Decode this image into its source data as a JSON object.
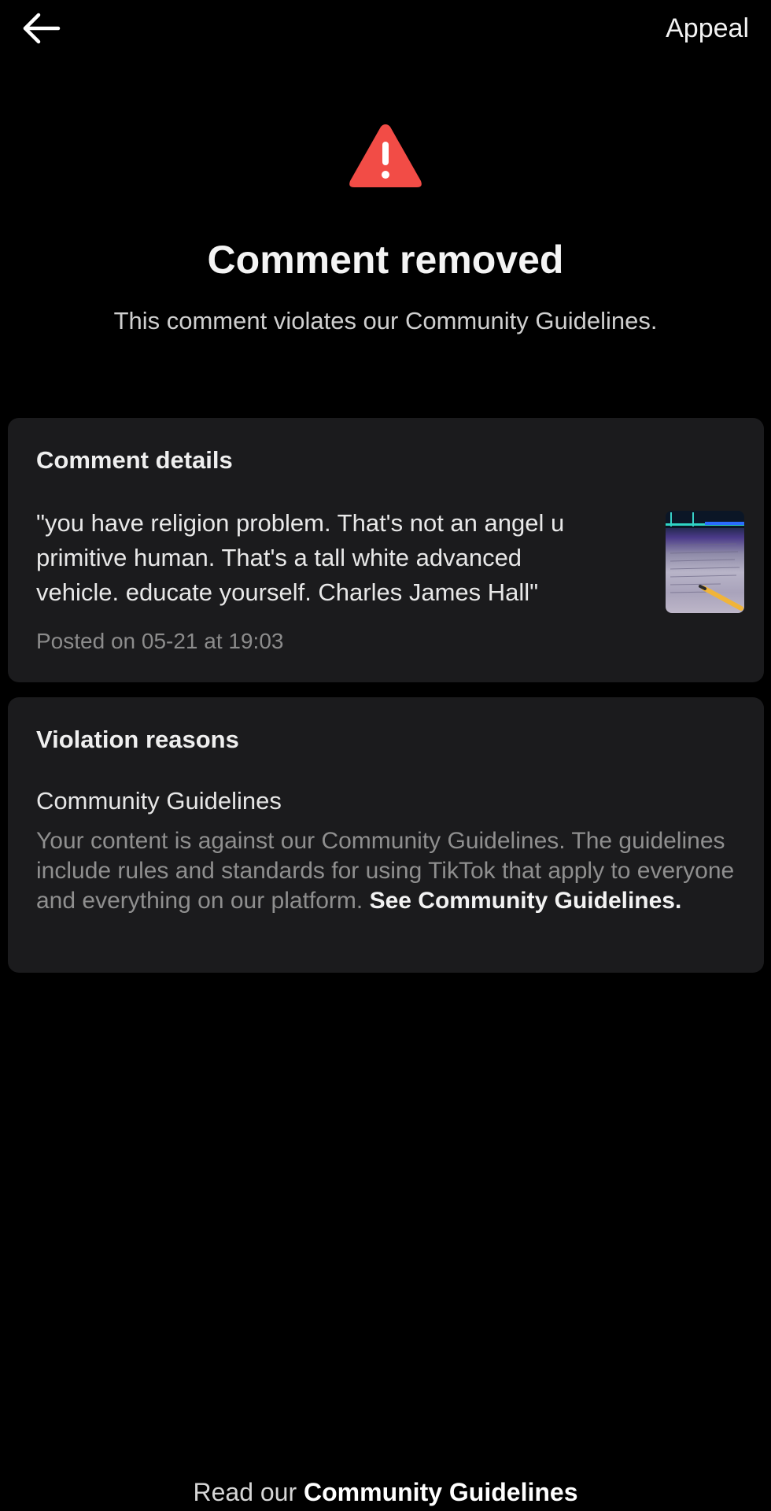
{
  "header": {
    "back_icon": "arrow-left-icon",
    "appeal_label": "Appeal"
  },
  "hero": {
    "icon": "warning-triangle-icon",
    "icon_color": "#f24c46",
    "title": "Comment removed",
    "subtitle": "This comment violates our Community Guidelines."
  },
  "comment_details": {
    "heading": "Comment details",
    "text": "\"you have religion problem. That's not an angel u\nprimitive human. That's a tall white advanced\nvehicle. educate yourself. Charles James Hall\"",
    "posted": "Posted on 05-21 at 19:03",
    "thumbnail_icon": "video-thumbnail"
  },
  "violation": {
    "heading": "Violation reasons",
    "reason_title": "Community Guidelines",
    "reason_desc": "Your content is against our Community Guidelines. The guidelines include rules and standards for using TikTok that apply to everyone and everything on our platform. ",
    "reason_link": "See Community Guidelines."
  },
  "footer": {
    "prefix": "Read our ",
    "link": "Community Guidelines"
  }
}
